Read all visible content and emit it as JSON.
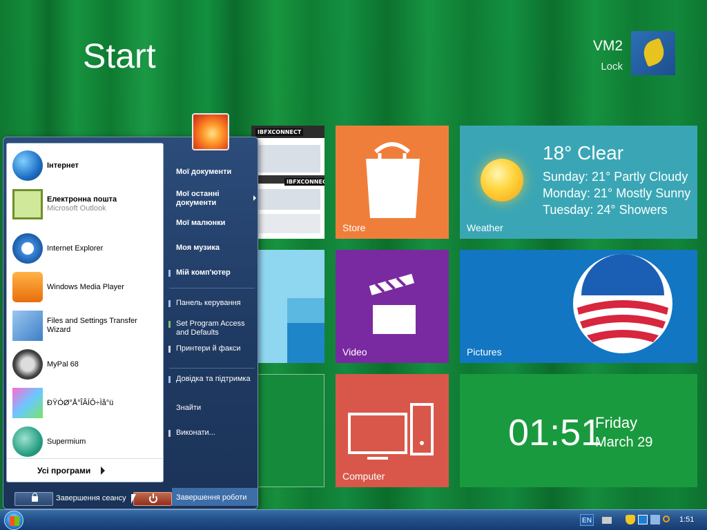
{
  "start_screen": {
    "title": "Start",
    "user_name": "VM2",
    "lock_label": "Lock"
  },
  "tiles": {
    "store": {
      "label": "Store"
    },
    "weather": {
      "label": "Weather",
      "current": "18° Clear",
      "forecast": [
        "Sunday: 21° Partly Cloudy",
        "Monday: 21° Mostly Sunny",
        "Tuesday: 24° Showers"
      ]
    },
    "video": {
      "label": "Video"
    },
    "pictures": {
      "label": "Pictures"
    },
    "computer": {
      "label": "Computer"
    },
    "clock": {
      "time": "01:51",
      "day": "Friday",
      "date": "March 29"
    },
    "browser_preview": {
      "brand": "IBFXCONNECT"
    }
  },
  "start_menu": {
    "programs": [
      {
        "name": "Інтернет",
        "sub": ""
      },
      {
        "name": "Електронна пошта",
        "sub": "Microsoft Outlook"
      },
      {
        "name": "Internet Explorer",
        "sub": ""
      },
      {
        "name": "Windows Media Player",
        "sub": ""
      },
      {
        "name": "Files and Settings Transfer Wizard",
        "sub": ""
      },
      {
        "name": "MyPal 68",
        "sub": ""
      },
      {
        "name": "ÐŸÓØ°Å°ÎÂÍÔ÷Ìå°ü",
        "sub": ""
      },
      {
        "name": "Supermium",
        "sub": ""
      }
    ],
    "all_programs": "Усі програми",
    "right_items": [
      "Мої документи",
      "Мої останні документи",
      "Мої малюнки",
      "Моя музика",
      "Мій комп'ютер",
      "Панель керування",
      "Set Program Access and Defaults",
      "Принтери й факси",
      "Довідка та підтримка",
      "Знайти",
      "Виконати..."
    ],
    "logoff_label": "Завершення сеансу",
    "shutdown_label": "Завершення роботи"
  },
  "taskbar": {
    "language": "EN",
    "time": "1:51"
  },
  "colors": {
    "store": "#f07e3b",
    "weather": "#3aa6b5",
    "video": "#7a2aa0",
    "pictures": "#1276c3",
    "computer": "#d9574a",
    "clock": "#1a9a3e"
  }
}
